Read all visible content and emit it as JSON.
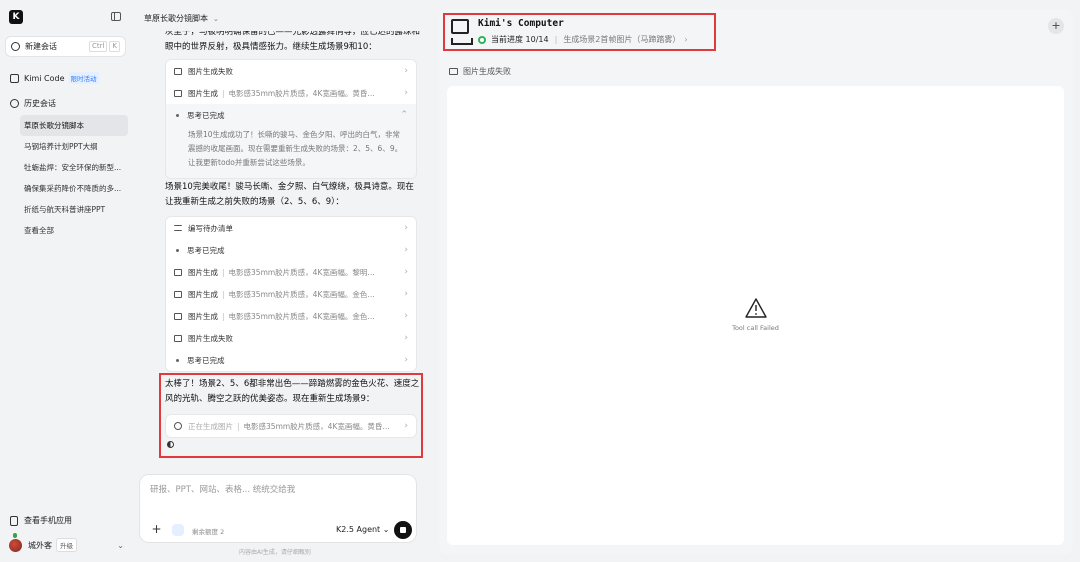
{
  "sidebar": {
    "logo": "K",
    "new_chat": {
      "label": "新建会话",
      "kbd": [
        "Ctrl",
        "K"
      ]
    },
    "kimi_code": {
      "label": "Kimi Code",
      "badge": "限时活动"
    },
    "history_label": "历史会话",
    "history": [
      "草原长歌分镜脚本",
      "马钢培养计划PPT大纲",
      "牡蛎盐焊：安全环保的新型...",
      "确保集采药降价不降质的多...",
      "折纸与航天科普讲座PPT",
      "查看全部"
    ],
    "mobile": "查看手机应用",
    "user": {
      "name": "城外客",
      "upgrade": "升级"
    }
  },
  "chat": {
    "title": "草原长歌分镜脚本",
    "top_text": "灰尘子，马被明明确保留的已——光影透露舞俏等，应匕达的露珠和眼中的世界反射，极具情感张力。继续生成场景9和10：",
    "card1": {
      "rows": [
        {
          "label": "图片生成失败",
          "desc": ""
        },
        {
          "label": "图片生成",
          "desc": "电影感35mm胶片质感，4K宽画幅。黄昏时分的..."
        }
      ],
      "thought_label": "思考已完成",
      "thought_text": "场景10生成成功了！长嘶的骏马、金色夕阳、呼出的白气，非常震撼的收尾画面。现在需要重新生成失败的场景：2、5、6、9。让我更新todo并重新尝试这些场景。"
    },
    "mid_text": "场景10完美收尾！骏马长嘶、金夕照、白气缭绕，极具诗意。现在让我重新生成之前失败的场景（2、5、6、9）：",
    "card2": {
      "rows": [
        {
          "type": "list",
          "label": "编写待办清单",
          "desc": ""
        },
        {
          "type": "dot",
          "label": "思考已完成",
          "desc": ""
        },
        {
          "type": "img",
          "label": "图片生成",
          "desc": "电影感35mm胶片质感，4K宽画幅。黎明时分的..."
        },
        {
          "type": "img",
          "label": "图片生成",
          "desc": "电影感35mm胶片质感，4K宽画幅。金色光线中..."
        },
        {
          "type": "img",
          "label": "图片生成",
          "desc": "电影感35mm胶片质感，4K宽画幅。金色黄昏的..."
        },
        {
          "type": "img",
          "label": "图片生成失败",
          "desc": ""
        },
        {
          "type": "dot",
          "label": "思考已完成",
          "desc": ""
        }
      ]
    },
    "latest_text": "太棒了！场景2、5、6都非常出色——蹄踏燃雾的金色火花、速度之风的光轨、腾空之跃的优美姿态。现在重新生成场景9：",
    "pending": {
      "label": "正在生成图片",
      "desc": "电影感35mm胶片质感，4K宽画幅。黄昏大..."
    },
    "composer": {
      "placeholder": "研报、PPT、网站、表格... 统统交给我",
      "quota": "剩余额度 2",
      "model": "K2.5 Agent ⌄"
    },
    "footnote": "内容由AI生成，请仔细甄别"
  },
  "panel": {
    "title": "Kimi's Computer",
    "progress": "当前进度 10/14",
    "step": "生成场景2首帧图片（马蹄踏雾）",
    "label": "图片生成失败",
    "error": "Tool call Failed"
  },
  "colors": {
    "accent": "#e0393e",
    "ok": "#2fb25a",
    "link": "#2f7cf6"
  }
}
